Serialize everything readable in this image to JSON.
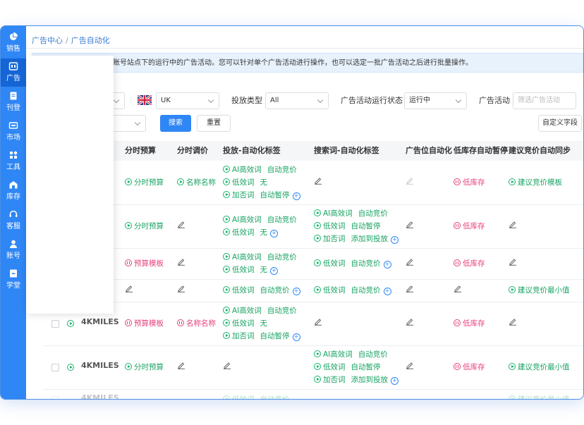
{
  "sidebar": {
    "items": [
      {
        "label": "销售",
        "icon": "pie-chart-icon"
      },
      {
        "label": "广告",
        "icon": "ad-icon",
        "active": true
      },
      {
        "label": "刊登",
        "icon": "document-icon"
      },
      {
        "label": "市场",
        "icon": "market-icon"
      },
      {
        "label": "工具",
        "icon": "tools-icon"
      },
      {
        "label": "库存",
        "icon": "warehouse-icon"
      },
      {
        "label": "客服",
        "icon": "headset-icon"
      },
      {
        "label": "账号",
        "icon": "user-icon"
      },
      {
        "label": "学堂",
        "icon": "book-icon"
      }
    ]
  },
  "breadcrumb": {
    "root": "广告中心",
    "separator": "/",
    "current": "广告自动化"
  },
  "notice": "账号站点下的运行中的广告活动。您可以针对单个广告活动进行操作，也可以选定一批广告活动之后进行批量操作。",
  "filters": {
    "site_value": "UK",
    "placement_type_label": "投放类型",
    "placement_type_value": "All",
    "status_label": "广告活动运行状态",
    "status_value": "运行中",
    "campaign_label": "广告活动",
    "campaign_placeholder": "筛选广告活动",
    "search_button": "搜索",
    "reset_button": "重置",
    "custom_fields_button": "自定义字段"
  },
  "table": {
    "headers": [
      "分时预算",
      "分时调价",
      "投放-自动化标签",
      "搜索词-自动化标签",
      "广告位自动化",
      "低库存自动暂停",
      "建议竞价自动同步"
    ],
    "labels": {
      "ai": "AI高效词",
      "auto_bid": "自动竞价",
      "low": "低效词",
      "none": "无",
      "neg": "加否词",
      "auto_pause": "自动暂停",
      "add_to_targeting": "添加到投放",
      "time_budget": "分时预算",
      "budget_template": "预算模板",
      "name_name": "名称名称",
      "low_stock": "低库存",
      "suggest_template": "建议竞价模板",
      "suggest_min": "建议竞价最小值"
    },
    "rows": [
      {
        "name": "4KMILES"
      },
      {
        "name": "4KMILES"
      },
      {
        "name": "4KMILES"
      }
    ]
  },
  "colors": {
    "primary": "#2f86f5",
    "green": "#18b36b",
    "pink": "#e5417d",
    "notice_bg": "#e8f2fd"
  }
}
